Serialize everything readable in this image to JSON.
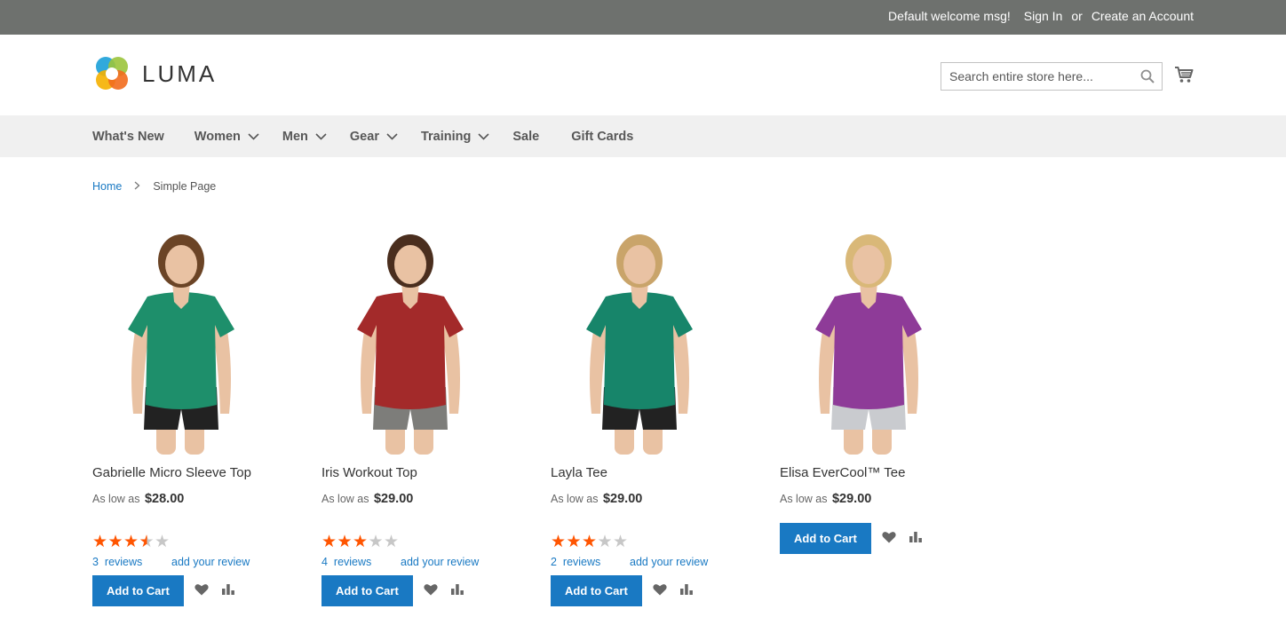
{
  "topbar": {
    "welcome": "Default welcome msg!",
    "sign_in": "Sign In",
    "or": "or",
    "create_account": "Create an Account"
  },
  "header": {
    "logo_text": "LUMA",
    "search_placeholder": "Search entire store here..."
  },
  "nav": {
    "items": [
      {
        "label": "What's New",
        "has_dropdown": false
      },
      {
        "label": "Women",
        "has_dropdown": true
      },
      {
        "label": "Men",
        "has_dropdown": true
      },
      {
        "label": "Gear",
        "has_dropdown": true
      },
      {
        "label": "Training",
        "has_dropdown": true
      },
      {
        "label": "Sale",
        "has_dropdown": false
      },
      {
        "label": "Gift Cards",
        "has_dropdown": false
      }
    ]
  },
  "breadcrumb": {
    "home": "Home",
    "current": "Simple Page"
  },
  "products": [
    {
      "name": "Gabrielle Micro Sleeve Top",
      "price_prefix": "As low as",
      "price": "$28.00",
      "rating": 3.5,
      "reviews_count": "3",
      "reviews_label": "reviews",
      "add_review": "add your review",
      "add_to_cart": "Add to Cart",
      "shirt_color": "#1e8f6b",
      "bottom_color": "#222222",
      "hair_color": "#6b4426"
    },
    {
      "name": "Iris Workout Top",
      "price_prefix": "As low as",
      "price": "$29.00",
      "rating": 3,
      "reviews_count": "4",
      "reviews_label": "reviews",
      "add_review": "add your review",
      "add_to_cart": "Add to Cart",
      "shirt_color": "#a32a2a",
      "bottom_color": "#7d7d7a",
      "hair_color": "#4a2e1e"
    },
    {
      "name": "Layla Tee",
      "price_prefix": "As low as",
      "price": "$29.00",
      "rating": 3,
      "reviews_count": "2",
      "reviews_label": "reviews",
      "add_review": "add your review",
      "add_to_cart": "Add to Cart",
      "shirt_color": "#17856a",
      "bottom_color": "#222222",
      "hair_color": "#c9a46a"
    },
    {
      "name": "Elisa EverCool™ Tee",
      "price_prefix": "As low as",
      "price": "$29.00",
      "rating": null,
      "add_to_cart": "Add to Cart",
      "shirt_color": "#8e3b98",
      "bottom_color": "#c9cbcf",
      "hair_color": "#d9b878"
    }
  ],
  "colors": {
    "topbar": "#6e716e",
    "nav_bg": "#f0f0f0",
    "link": "#1979c3",
    "button": "#1979c3",
    "star_on": "#ff5501",
    "star_off": "#c7c7c7"
  }
}
